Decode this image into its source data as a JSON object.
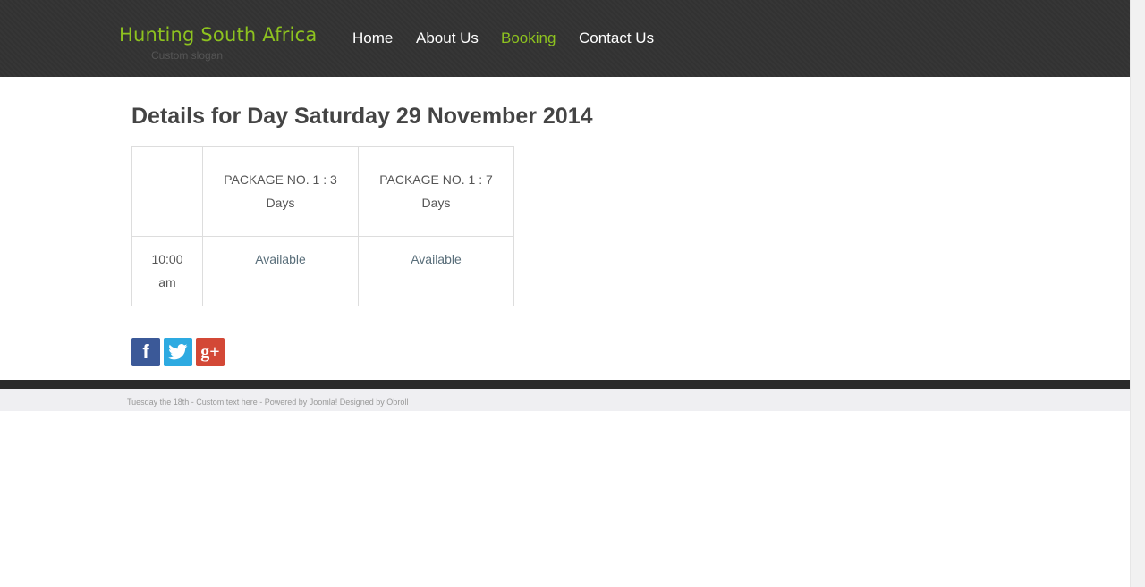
{
  "site": {
    "logo": "Hunting South Africa",
    "slogan": "Custom slogan"
  },
  "nav": {
    "items": [
      {
        "label": "Home"
      },
      {
        "label": "About Us"
      },
      {
        "label": "Booking",
        "active": true
      },
      {
        "label": "Contact Us"
      }
    ]
  },
  "main": {
    "title": "Details for Day Saturday 29 November 2014",
    "table": {
      "headers": [
        "",
        "PACKAGE NO. 1 : 3 Days",
        "PACKAGE NO. 1 : 7 Days"
      ],
      "rows": [
        {
          "time": "10:00 am",
          "cells": [
            "Available",
            "Available"
          ]
        }
      ]
    }
  },
  "social": {
    "icons": [
      "facebook-icon",
      "twitter-icon",
      "google-plus-icon"
    ],
    "facebook_glyph": "f",
    "google_glyph": "g+"
  },
  "footer": {
    "text": "Tuesday the 18th - Custom text here - Powered by Joomla! Designed by Obroll"
  },
  "colors": {
    "header_bg": "#333333",
    "accent": "#8dc21f",
    "facebook": "#3b5998",
    "twitter": "#2daae1",
    "google_plus": "#d34836"
  }
}
